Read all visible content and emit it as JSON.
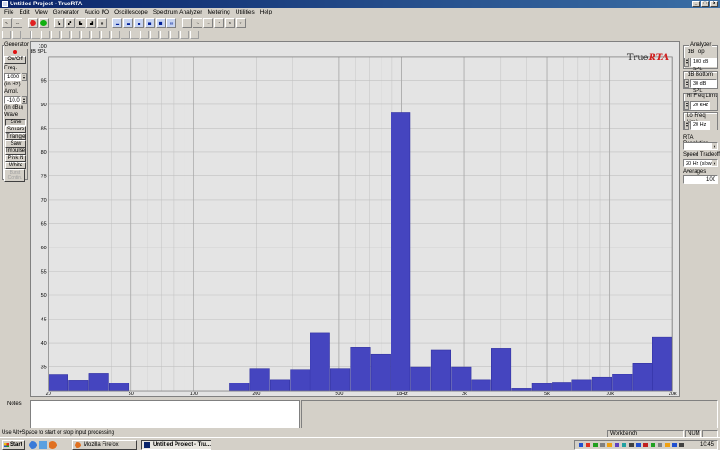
{
  "window": {
    "title": "Untitled Project - TrueRTA"
  },
  "menu": [
    "File",
    "Edit",
    "View",
    "Generator",
    "Audio I/O",
    "Oscilloscope",
    "Spectrum Analyzer",
    "Metering",
    "Utilities",
    "Help"
  ],
  "generator": {
    "title": "Generator",
    "onoff": "On/Off",
    "freq_label": "Freq.",
    "freq_value": "1000",
    "freq_unit": "(in Hz)",
    "ampl_label": "Ampl.",
    "ampl_value": "-10.0",
    "ampl_unit": "(in dBu)",
    "wave_label": "Wave",
    "waves": [
      "Sine",
      "Square",
      "Triangle",
      "Saw",
      "Impulse",
      "Pink N",
      "White N"
    ],
    "disabled_label": "Burst\nContin."
  },
  "right_panel": {
    "analyzer_label": "Analyzer",
    "db_top_label": "dB Top",
    "db_top_value": "100 dB SPL",
    "db_bottom_label": "dB Bottom",
    "db_bottom_value": "30 dB SPL",
    "hi_freq_label": "Hi Freq Limit",
    "hi_freq_value": "20 kHz",
    "lo_freq_label": "Lo Freq Limit",
    "lo_freq_value": "20 Hz",
    "rta_resolution_label": "RTA Resolution",
    "rta_resolution_value": "",
    "speed_label": "Speed Tradeoff",
    "speed_value": "20 Hz (slow)",
    "averages_label": "Averages",
    "averages_value": "100"
  },
  "notes": {
    "label": "Notes:"
  },
  "status": {
    "hint": "Use Alt+Space to start or stop input processing",
    "workbench": "Workbench",
    "num": "NUM"
  },
  "taskbar": {
    "start": "Start",
    "tasks": [
      "Mozilla Firefox",
      "Untitled Project - Tru..."
    ],
    "clock": "10:45"
  },
  "chart_data": {
    "type": "bar",
    "brand": "TrueRTA",
    "ylabel": "dB SPL",
    "ylim": [
      30,
      100
    ],
    "yticks": [
      35,
      40,
      45,
      50,
      55,
      60,
      65,
      70,
      75,
      80,
      85,
      90,
      95
    ],
    "ytop_label": "100",
    "xscale": "log",
    "xlim": [
      20,
      20000
    ],
    "xtick_labels": [
      {
        "f": 20,
        "label": "20"
      },
      {
        "f": 50,
        "label": "50"
      },
      {
        "f": 100,
        "label": "100"
      },
      {
        "f": 200,
        "label": "200"
      },
      {
        "f": 500,
        "label": "500"
      },
      {
        "f": 1000,
        "label": "1kHz"
      },
      {
        "f": 2000,
        "label": "2k"
      },
      {
        "f": 5000,
        "label": "5k"
      },
      {
        "f": 10000,
        "label": "10k"
      },
      {
        "f": 20000,
        "label": "20k"
      }
    ],
    "bar_color": "#4545bf",
    "bars": [
      {
        "f": 20,
        "v": 33.3
      },
      {
        "f": 25,
        "v": 32.2
      },
      {
        "f": 31.5,
        "v": 33.7
      },
      {
        "f": 40,
        "v": 31.6
      },
      {
        "f": 50,
        "v": 30
      },
      {
        "f": 63,
        "v": 30
      },
      {
        "f": 80,
        "v": 30
      },
      {
        "f": 100,
        "v": 30
      },
      {
        "f": 125,
        "v": 30
      },
      {
        "f": 160,
        "v": 31.6
      },
      {
        "f": 200,
        "v": 34.6
      },
      {
        "f": 250,
        "v": 32.3
      },
      {
        "f": 315,
        "v": 34.4
      },
      {
        "f": 400,
        "v": 42.1
      },
      {
        "f": 500,
        "v": 34.6
      },
      {
        "f": 630,
        "v": 39.0
      },
      {
        "f": 800,
        "v": 37.7
      },
      {
        "f": 1000,
        "v": 88.2
      },
      {
        "f": 1250,
        "v": 34.9
      },
      {
        "f": 1600,
        "v": 38.5
      },
      {
        "f": 2000,
        "v": 34.9
      },
      {
        "f": 2500,
        "v": 32.3
      },
      {
        "f": 3150,
        "v": 38.8
      },
      {
        "f": 4000,
        "v": 30.5
      },
      {
        "f": 5000,
        "v": 31.5
      },
      {
        "f": 6300,
        "v": 31.8
      },
      {
        "f": 8000,
        "v": 32.3
      },
      {
        "f": 10000,
        "v": 32.8
      },
      {
        "f": 12500,
        "v": 33.4
      },
      {
        "f": 16000,
        "v": 35.8
      },
      {
        "f": 20000,
        "v": 41.3
      }
    ]
  }
}
